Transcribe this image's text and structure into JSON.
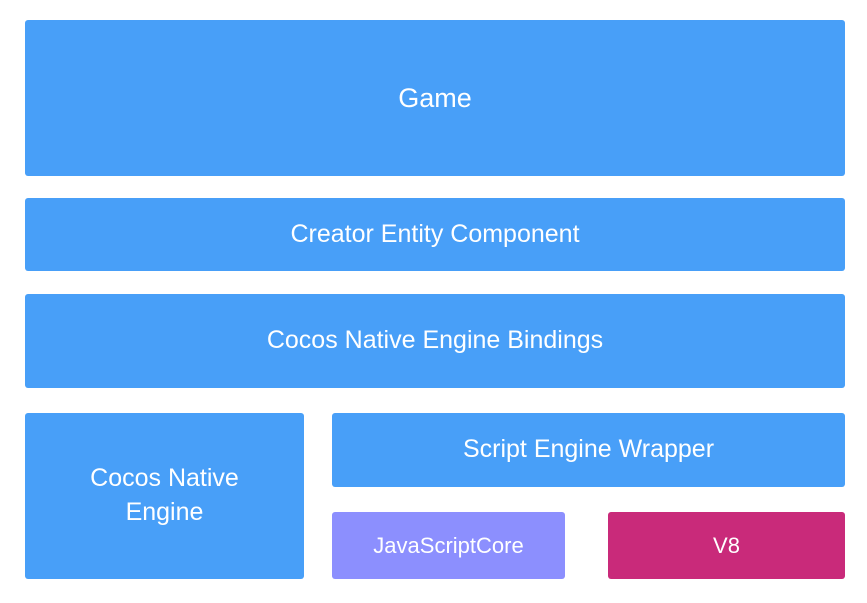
{
  "colors": {
    "blue": "#489ff8",
    "purple": "#8c8ffe",
    "magenta": "#c92a7a"
  },
  "layers": {
    "game": "Game",
    "creator": "Creator Entity Component",
    "bindings": "Cocos Native Engine Bindings",
    "native_engine_line1": "Cocos Native",
    "native_engine_line2": "Engine",
    "wrapper": "Script Engine Wrapper",
    "jsc": "JavaScriptCore",
    "v8": "V8"
  }
}
